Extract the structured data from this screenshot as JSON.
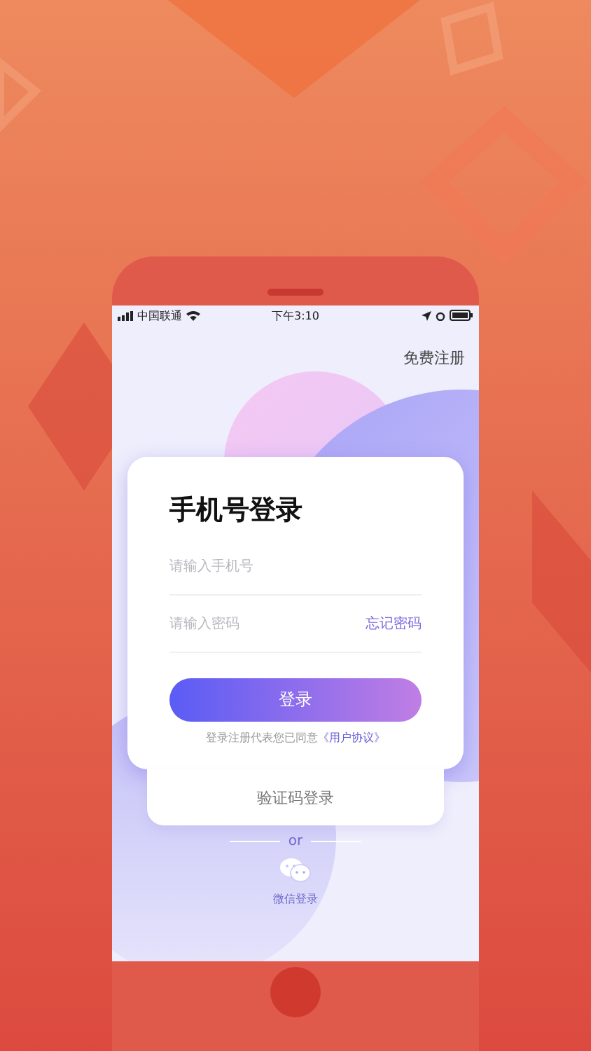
{
  "status_bar": {
    "carrier": "中国联通",
    "time": "下午3:10"
  },
  "register_link": "免费注册",
  "login_card": {
    "title": "手机号登录",
    "phone_field": {
      "placeholder": "请输入手机号"
    },
    "password_field": {
      "placeholder": "请输入密码"
    },
    "forgot_password": "忘记密码",
    "login_button": "登录",
    "agreement_text": "登录注册代表您已同意",
    "agreement_link": "《用户协议》"
  },
  "code_login_button": "验证码登录",
  "divider_text": "or",
  "wechat_login": "微信登录"
}
